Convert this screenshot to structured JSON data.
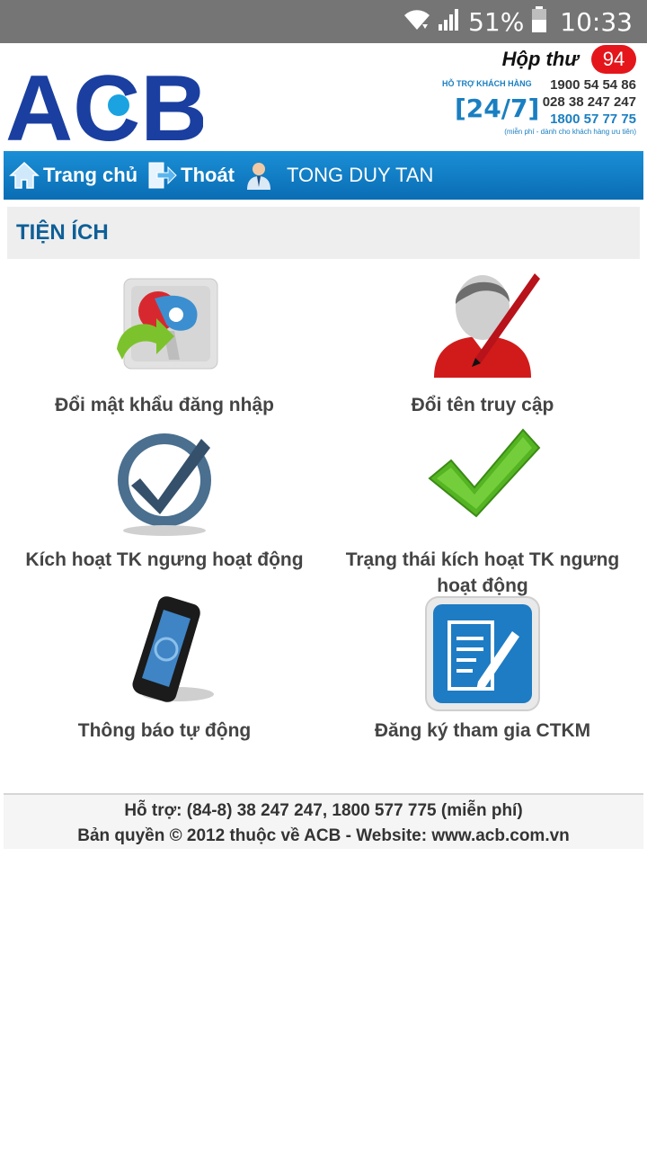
{
  "status_bar": {
    "battery_percent": "51%",
    "time": "10:33",
    "icons": [
      "wifi-icon",
      "signal-icon",
      "battery-icon"
    ]
  },
  "header": {
    "logo_text": "ACB",
    "inbox_label": "Hộp thư",
    "inbox_count": "94",
    "hotline": {
      "caption": "HỖ TRỢ KHÁCH HÀNG",
      "badge": "[24/7]",
      "numbers": [
        "1900 54 54 86",
        "028 38 247 247",
        "1800 57 77 75"
      ],
      "note": "(miễn phí - dành cho khách hàng ưu tiên)"
    }
  },
  "nav": {
    "home_label": "Trang chủ",
    "logout_label": "Thoát",
    "user_name": "TONG DUY TAN"
  },
  "section_title": "TIỆN ÍCH",
  "tiles": [
    {
      "label": "Đổi mật khẩu đăng nhập",
      "icon": "change-password-icon"
    },
    {
      "label": "Đổi tên truy cập",
      "icon": "edit-user-icon"
    },
    {
      "label": "Kích hoạt TK ngưng hoạt động",
      "icon": "checkmark-circle-icon"
    },
    {
      "label": "Trạng thái kích hoạt TK ngưng hoạt động",
      "icon": "green-check-icon"
    },
    {
      "label": "Thông báo tự động",
      "icon": "phone-icon"
    },
    {
      "label": "Đăng ký tham gia CTKM",
      "icon": "document-pen-icon"
    }
  ],
  "footer": {
    "support": "Hỗ trợ: (84-8) 38 247 247, 1800 577 775 (miễn phí)",
    "copyright": "Bản quyền © 2012 thuộc về ACB - Website: www.acb.com.vn"
  },
  "colors": {
    "brand_blue": "#1a3fa0",
    "nav_blue": "#0a6db4",
    "section_text": "#0e5f97",
    "badge_red": "#e4161b"
  }
}
